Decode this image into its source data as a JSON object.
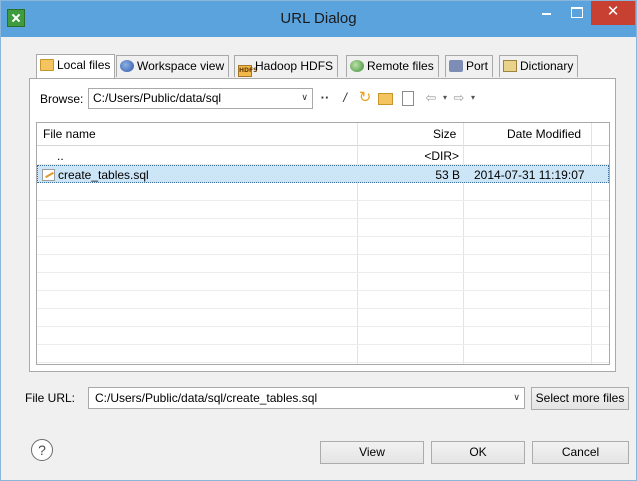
{
  "window": {
    "title": "URL Dialog",
    "close_glyph": "✕"
  },
  "tabs": [
    {
      "label": "Local files",
      "icon": "folder-icon",
      "active": true
    },
    {
      "label": "Workspace view",
      "icon": "globe-icon"
    },
    {
      "label": "Hadoop HDFS",
      "icon": "hdfs-icon",
      "icon_text": "HDFS"
    },
    {
      "label": "Remote files",
      "icon": "remote-icon"
    },
    {
      "label": "Port",
      "icon": "port-icon"
    },
    {
      "label": "Dictionary",
      "icon": "dictionary-icon"
    }
  ],
  "browse": {
    "label": "Browse:",
    "path": "C:/Users/Public/data/sql",
    "toolbar": {
      "up": "··",
      "root": "/",
      "back": "⇦",
      "forward": "⇨",
      "dropdown": "▾"
    }
  },
  "table": {
    "columns": {
      "name": "File name",
      "size": "Size",
      "date": "Date Modified"
    },
    "rows": [
      {
        "name": "..",
        "size": "<DIR>",
        "date": ""
      },
      {
        "name": "create_tables.sql",
        "size": "53 B",
        "date": "2014-07-31 11:19:07",
        "selected": true
      }
    ]
  },
  "file_url": {
    "label": "File URL:",
    "value": "C:/Users/Public/data/sql/create_tables.sql",
    "select_more_label": "Select more files"
  },
  "buttons": {
    "view": "View",
    "ok": "OK",
    "cancel": "Cancel",
    "help": "?"
  },
  "colors": {
    "titlebar": "#5aa3dd",
    "close": "#c84031",
    "selection": "#cde6f7"
  }
}
